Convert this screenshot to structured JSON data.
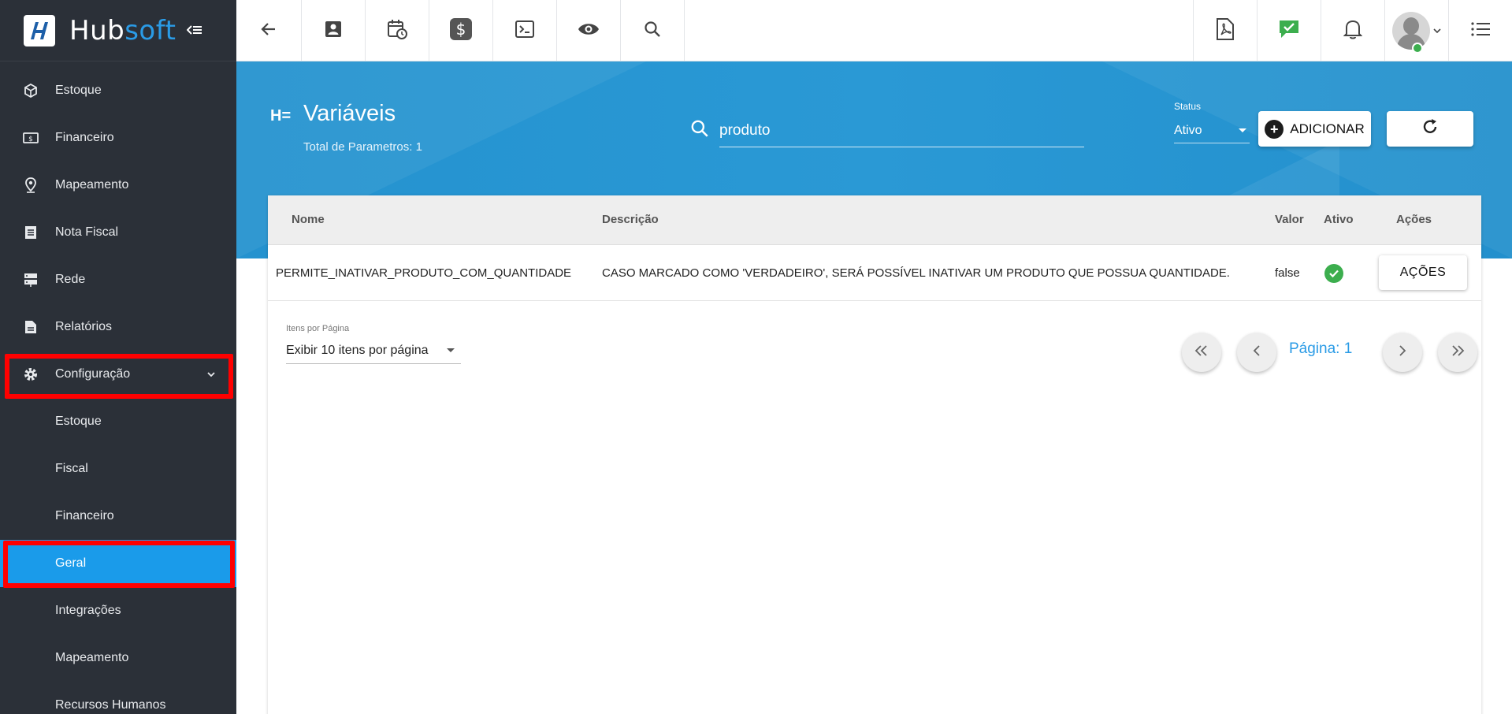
{
  "brand": {
    "name_a": "Hub",
    "name_b": "soft"
  },
  "sidebar": {
    "items": [
      {
        "label": "Estoque",
        "icon": "box-icon"
      },
      {
        "label": "Financeiro",
        "icon": "money-icon"
      },
      {
        "label": "Mapeamento",
        "icon": "map-pin-icon"
      },
      {
        "label": "Nota Fiscal",
        "icon": "receipt-icon"
      },
      {
        "label": "Rede",
        "icon": "server-icon"
      },
      {
        "label": "Relatórios",
        "icon": "document-icon"
      },
      {
        "label": "Configuração",
        "icon": "gear-icon"
      }
    ],
    "subitems": [
      {
        "label": "Estoque"
      },
      {
        "label": "Fiscal"
      },
      {
        "label": "Financeiro"
      },
      {
        "label": "Geral",
        "active": true
      },
      {
        "label": "Integrações"
      },
      {
        "label": "Mapeamento"
      },
      {
        "label": "Recursos Humanos"
      }
    ]
  },
  "page": {
    "title": "Variáveis",
    "subtitle": "Total de Parametros: 1"
  },
  "search": {
    "value": "produto"
  },
  "status": {
    "label": "Status",
    "value": "Ativo"
  },
  "buttons": {
    "add": "ADICIONAR"
  },
  "table": {
    "headers": {
      "nome": "Nome",
      "descricao": "Descrição",
      "valor": "Valor",
      "ativo": "Ativo",
      "acoes": "Ações"
    },
    "rows": [
      {
        "nome": "PERMITE_INATIVAR_PRODUTO_COM_QUANTIDADE",
        "descricao": "CASO MARCADO COMO 'VERDADEIRO', SERÁ POSSÍVEL INATIVAR UM PRODUTO QUE POSSUA QUANTIDADE.",
        "valor": "false",
        "ativo": true,
        "acoes": "AÇÕES"
      }
    ]
  },
  "pagination": {
    "items_label": "Itens por Página",
    "items_value": "Exibir 10 itens por página",
    "page_label": "Página: 1"
  },
  "colors": {
    "accent": "#1a9bea",
    "sidebar": "#2b3038",
    "highlight": "#ff0000",
    "success": "#3cae4e"
  }
}
